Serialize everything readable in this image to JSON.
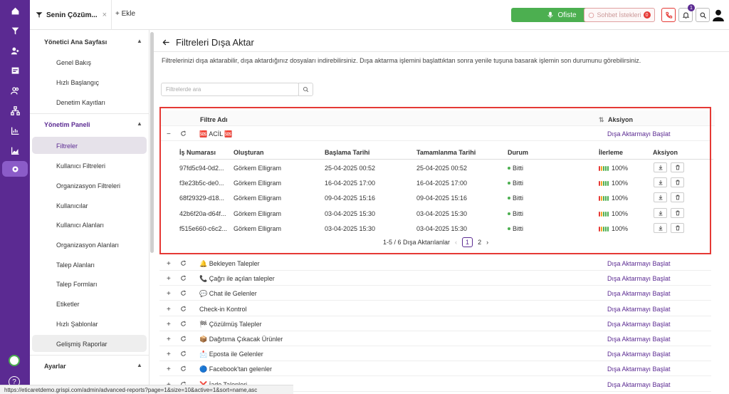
{
  "rail": {
    "icons": [
      "home-icon",
      "filter-icon",
      "users-icon",
      "report-icon",
      "contacts-icon",
      "org-icon",
      "chart-icon",
      "chart-area-icon",
      "settings-icon"
    ]
  },
  "topbar": {
    "tab_title": "Senin Çözüm...",
    "tab_close": "×",
    "add_label": "+ Ekle",
    "office_label": "Ofiste",
    "chat_requests_label": "Sohbet İstekleri",
    "chat_requests_count": "0",
    "notif_count": "1"
  },
  "sidebar": {
    "section1": "Yönetici Ana Sayfası",
    "items1": [
      "Genel Bakış",
      "Hızlı Başlangıç",
      "Denetim Kayıtları"
    ],
    "section2": "Yönetim Paneli",
    "items2": [
      "Filtreler",
      "Kullanıcı Filtreleri",
      "Organizasyon Filtreleri",
      "Kullanıcılar",
      "Kullanıcı Alanları",
      "Organizasyon Alanları",
      "Talep Alanları",
      "Talep Formları",
      "Etiketler",
      "Hızlı Şablonlar",
      "Gelişmiş Raporlar"
    ],
    "section3": "Ayarlar"
  },
  "status_url": "https://eticaretdemo.grispi.com/admin/advanced-reports?page=1&size=10&active=1&sort=name,asc",
  "page": {
    "title": "Filtreleri Dışa Aktar",
    "description": "Filtrelerinizi dışa aktarabilir, dışa aktardığınız dosyaları indirebilirsiniz. Dışa aktarma işlemini başlattıktan sonra yenile tuşuna basarak işlemin son durumunu görebilirsiniz.",
    "search_placeholder": "Filtrelerde ara"
  },
  "table": {
    "col_name": "Filtre Adı",
    "col_action": "Aksiyon",
    "export_label": "Dışa Aktarmayı Başlat",
    "expanded": {
      "name": "🆘 ACİL 🆘",
      "sub_headers": [
        "İş Numarası",
        "Oluşturan",
        "Başlama Tarihi",
        "Tamamlanma Tarihi",
        "Durum",
        "İlerleme",
        "Aksiyon"
      ],
      "rows": [
        {
          "id": "97fd5c94-0d2...",
          "by": "Görkem Elligram",
          "start": "25-04-2025 00:52",
          "end": "25-04-2025 00:52",
          "status": "Bitti",
          "progress": "100%"
        },
        {
          "id": "f3e23b5c-de0...",
          "by": "Görkem Elligram",
          "start": "16-04-2025 17:00",
          "end": "16-04-2025 17:00",
          "status": "Bitti",
          "progress": "100%"
        },
        {
          "id": "68f29329-d18...",
          "by": "Görkem Elligram",
          "start": "09-04-2025 15:16",
          "end": "09-04-2025 15:16",
          "status": "Bitti",
          "progress": "100%"
        },
        {
          "id": "42b6f20a-d64f...",
          "by": "Görkem Elligram",
          "start": "03-04-2025 15:30",
          "end": "03-04-2025 15:30",
          "status": "Bitti",
          "progress": "100%"
        },
        {
          "id": "f515e660-c6c2...",
          "by": "Görkem Elligram",
          "start": "03-04-2025 15:30",
          "end": "03-04-2025 15:30",
          "status": "Bitti",
          "progress": "100%"
        }
      ],
      "pagination_text": "1-5 / 6 Dışa Aktarılanlar",
      "page1": "1",
      "page2": "2"
    },
    "other_filters": [
      "🔔 Bekleyen Talepler",
      "📞 Çağrı ile açılan talepler",
      "💬 Chat ile Gelenler",
      "Check-in Kontrol",
      "🏁 Çözülmüş Talepler",
      "📦 Dağıtıma Çıkacak Ürünler",
      "📩 Eposta ile Gelenler",
      "🔵 Facebook'tan gelenler",
      "❌ İade Talepleri"
    ]
  },
  "colors": {
    "brand": "#5b2a92",
    "office_green": "#4caf50",
    "highlight_red": "#e53935"
  }
}
